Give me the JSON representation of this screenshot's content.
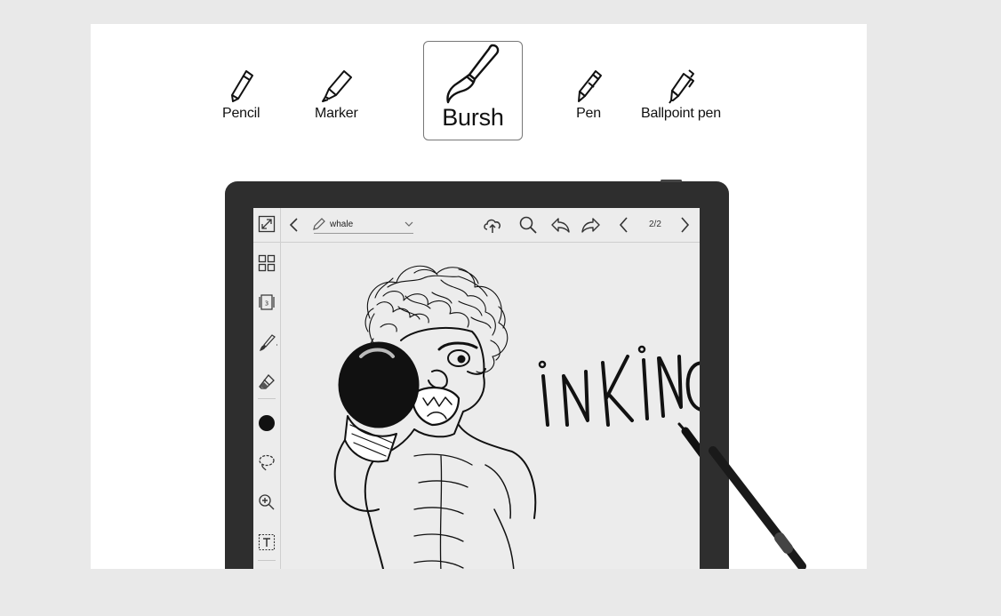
{
  "tools": [
    {
      "label": "Pencil",
      "icon": "pencil-icon"
    },
    {
      "label": "Marker",
      "icon": "marker-icon"
    },
    {
      "label": "Bursh",
      "icon": "brush-icon",
      "selected": true
    },
    {
      "label": "Pen",
      "icon": "pen-icon"
    },
    {
      "label": "Ballpoint pen",
      "icon": "ballpoint-pen-icon"
    }
  ],
  "device": {
    "doc_name": "whale",
    "page_indicator": "2/2",
    "sidebar_icons": [
      "expand-icon",
      "grid-icon",
      "page-number-icon",
      "brush-icon",
      "eraser-icon",
      "color-dot-icon",
      "lasso-icon",
      "zoom-icon",
      "text-icon"
    ],
    "toolbar_icons": [
      "back-icon",
      "pencil-icon",
      "dropdown-icon",
      "cloud-sync-icon",
      "search-icon",
      "undo-icon",
      "redo-icon",
      "prev-page-icon",
      "next-page-icon"
    ],
    "canvas_lettering": "inKinG"
  },
  "colors": {
    "page_bg": "#e9e9e9",
    "card_bg": "#ffffff",
    "device_frame": "#2e2e2e",
    "screen_bg": "#ececec"
  }
}
